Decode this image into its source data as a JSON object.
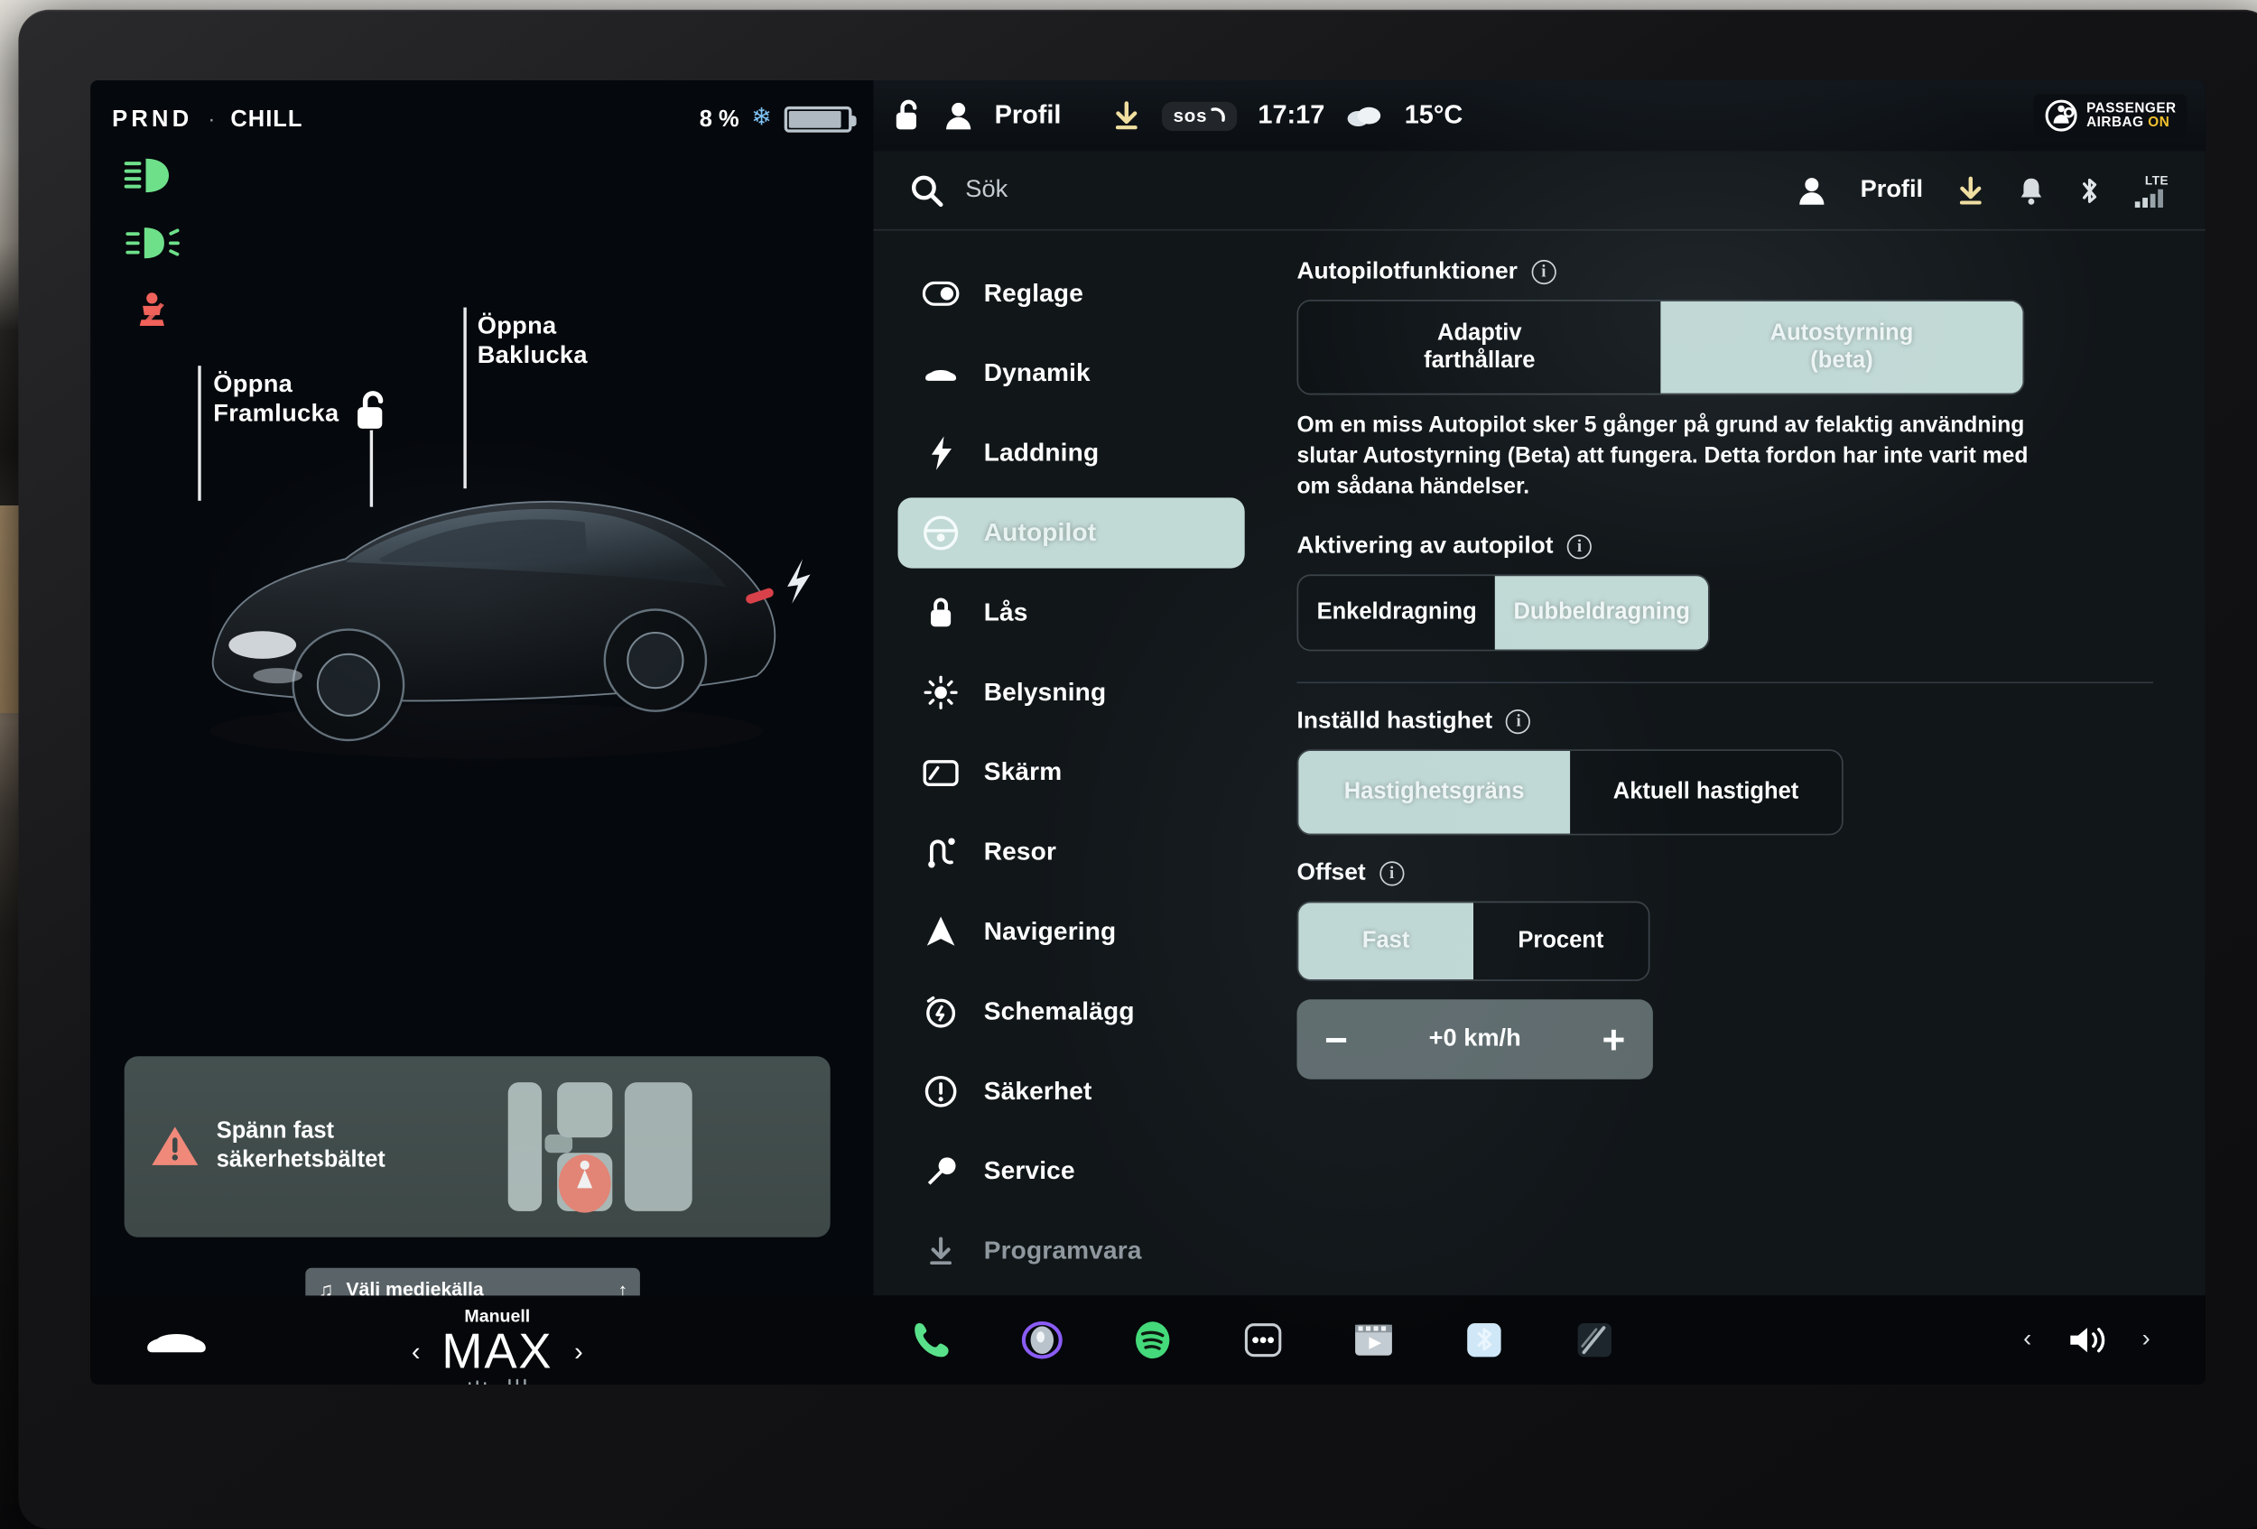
{
  "left": {
    "gear": "PRND",
    "separator": "·",
    "drive_mode": "CHILL",
    "battery_percent": "8 %",
    "tell_tales": [
      "low-beam-headlight-icon",
      "fog-light-icon",
      "seatbelt-warning-icon"
    ],
    "callouts": {
      "front_trunk": "Öppna\nFramlucka",
      "front_trunk_line1": "Öppna",
      "front_trunk_line2": "Framlucka",
      "rear_trunk_line1": "Öppna",
      "rear_trunk_line2": "Baklucka"
    },
    "alert": {
      "line1": "Spänn fast",
      "line2": "säkerhetsbältet"
    },
    "media": {
      "label": "Välj mediekälla"
    }
  },
  "topbar": {
    "profile": "Profil",
    "sos": "sos",
    "clock": "17:17",
    "temperature": "15°C",
    "airbag_line1": "PASSENGER",
    "airbag_line2": "AIRBAG",
    "airbag_state": "ON"
  },
  "settings": {
    "search_placeholder": "Sök",
    "header_profile": "Profil",
    "menu": [
      {
        "label": "Reglage",
        "icon": "toggle-icon",
        "active": false
      },
      {
        "label": "Dynamik",
        "icon": "car-icon",
        "active": false
      },
      {
        "label": "Laddning",
        "icon": "bolt-icon",
        "active": false
      },
      {
        "label": "Autopilot",
        "icon": "steering-wheel-icon",
        "active": true
      },
      {
        "label": "Lås",
        "icon": "lock-icon",
        "active": false
      },
      {
        "label": "Belysning",
        "icon": "sun-icon",
        "active": false
      },
      {
        "label": "Skärm",
        "icon": "display-icon",
        "active": false
      },
      {
        "label": "Resor",
        "icon": "route-icon",
        "active": false
      },
      {
        "label": "Navigering",
        "icon": "navigation-arrow-icon",
        "active": false
      },
      {
        "label": "Schemalägg",
        "icon": "alarm-icon",
        "active": false
      },
      {
        "label": "Säkerhet",
        "icon": "exclamation-circle-icon",
        "active": false
      },
      {
        "label": "Service",
        "icon": "wrench-icon",
        "active": false
      },
      {
        "label": "Programvara",
        "icon": "download-icon",
        "active": false
      }
    ],
    "sections": {
      "features": {
        "title": "Autopilotfunktioner",
        "option_left_line1": "Adaptiv",
        "option_left_line2": "farthållare",
        "option_right_line1": "Autostyrning",
        "option_right_line2": "(beta)",
        "selected": "Autostyrning (beta)",
        "description": "Om en miss Autopilot sker 5 gånger på grund av felaktig användning slutar Autostyrning (Beta) att fungera. Detta fordon har inte varit med om sådana händelser."
      },
      "activation": {
        "title": "Aktivering av autopilot",
        "option_left": "Enkeldragning",
        "option_right": "Dubbeldragning",
        "selected": "Dubbeldragning"
      },
      "set_speed": {
        "title": "Inställd hastighet",
        "option_left": "Hastighetsgräns",
        "option_right": "Aktuell hastighet",
        "selected": "Hastighetsgräns"
      },
      "offset": {
        "title": "Offset",
        "option_left": "Fast",
        "option_right": "Procent",
        "selected": "Fast",
        "stepper_minus": "−",
        "stepper_value": "+0 km/h",
        "stepper_plus": "+"
      }
    }
  },
  "hvac": {
    "mode": "Manuell",
    "temperature": "MAX",
    "chevron_left": "‹",
    "chevron_right": "›"
  },
  "apps": [
    {
      "name": "phone-icon"
    },
    {
      "name": "dashcam-icon"
    },
    {
      "name": "spotify-icon"
    },
    {
      "name": "more-apps-icon"
    },
    {
      "name": "theater-icon"
    },
    {
      "name": "toybox-icon"
    },
    {
      "name": "wiper-icon"
    }
  ],
  "volume": {
    "prev": "‹",
    "next": "›"
  },
  "colors": {
    "accent_mint": "#c2dad6",
    "warning_red": "#f0897a",
    "telltale_green": "#6ee08a",
    "battery_grey": "#aeb9c1",
    "amber": "#f2c12e"
  }
}
